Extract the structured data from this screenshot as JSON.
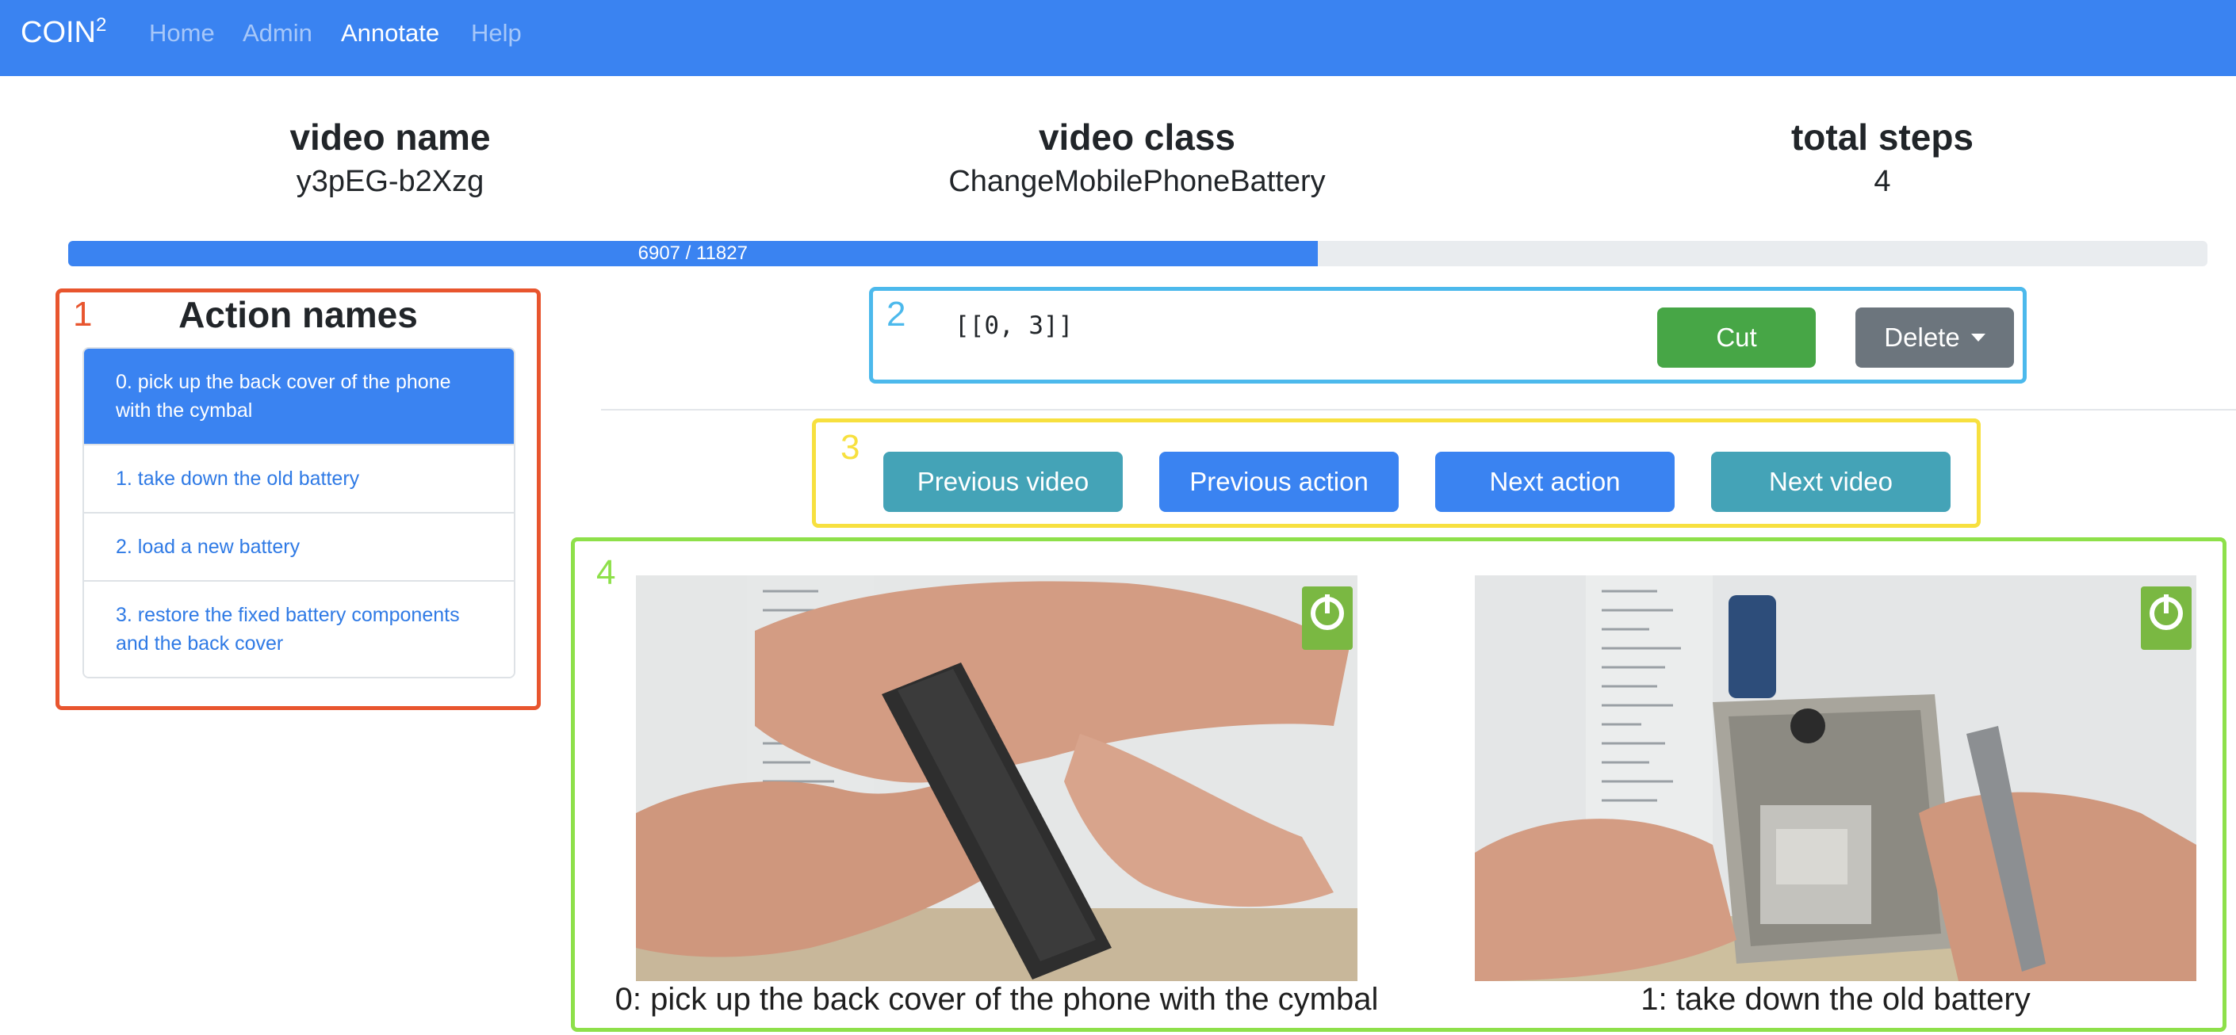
{
  "navbar": {
    "brand": "COIN",
    "brand_sup": "2",
    "links": [
      {
        "label": "Home",
        "active": false
      },
      {
        "label": "Admin",
        "active": false
      },
      {
        "label": "Annotate",
        "active": true
      },
      {
        "label": "Help",
        "active": false
      }
    ]
  },
  "info": {
    "video_name_label": "video name",
    "video_name_value": "y3pEG-b2Xzg",
    "video_class_label": "video class",
    "video_class_value": "ChangeMobilePhoneBattery",
    "total_steps_label": "total steps",
    "total_steps_value": "4"
  },
  "progress": {
    "text": "6907 / 11827",
    "current": 6907,
    "total": 11827
  },
  "annotation_numbers": [
    "1",
    "2",
    "3",
    "4"
  ],
  "actions": {
    "title": "Action names",
    "items": [
      {
        "label": "0. pick up the back cover of the phone with the cymbal",
        "active": true
      },
      {
        "label": "1. take down the old battery",
        "active": false
      },
      {
        "label": "2. load a new battery",
        "active": false
      },
      {
        "label": "3. restore the fixed battery components and the back cover",
        "active": false
      }
    ]
  },
  "segment": {
    "value": "[[0, 3]]",
    "cut_label": "Cut",
    "delete_label": "Delete"
  },
  "navigation": {
    "previous_video": "Previous video",
    "previous_action": "Previous action",
    "next_action": "Next action",
    "next_video": "Next video"
  },
  "videos": [
    {
      "caption": "0: pick up the back cover of the phone with the cymbal"
    },
    {
      "caption": "1: take down the old battery"
    }
  ],
  "colors": {
    "primary": "#3a83f1",
    "success": "#47a646",
    "secondary": "#6c757d",
    "info": "#44a3b7",
    "frame_1": "#e8552e",
    "frame_2": "#4cb9ec",
    "frame_3": "#f7e03f",
    "frame_4": "#8ee04a"
  }
}
